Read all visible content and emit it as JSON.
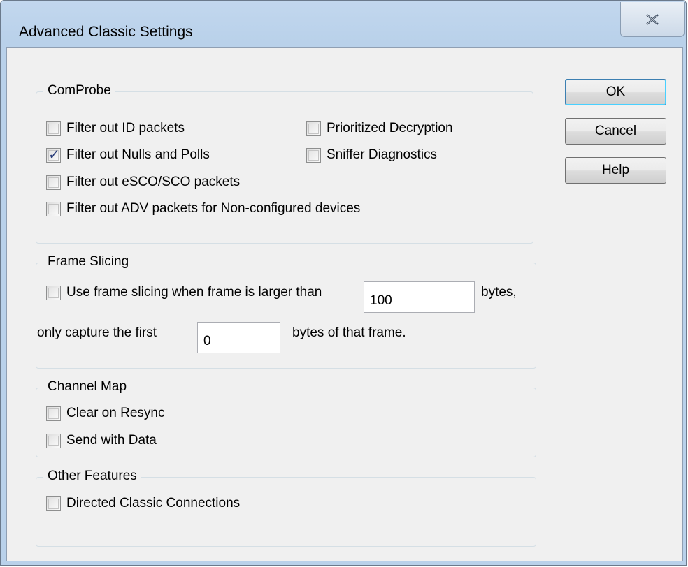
{
  "window": {
    "title": "Advanced Classic Settings",
    "close_icon": "close-x-icon"
  },
  "buttons": {
    "ok": "OK",
    "cancel": "Cancel",
    "help": "Help"
  },
  "comprobe": {
    "legend": "ComProbe",
    "options": [
      {
        "label": "Filter out ID packets",
        "checked": false
      },
      {
        "label": "Filter out Nulls and Polls",
        "checked": true
      },
      {
        "label": "Filter out eSCO/SCO packets",
        "checked": false
      },
      {
        "label": "Filter out ADV packets for Non-configured devices",
        "checked": false
      },
      {
        "label": "Prioritized Decryption",
        "checked": false
      },
      {
        "label": "Sniffer Diagnostics",
        "checked": false
      }
    ]
  },
  "frame_slicing": {
    "legend": "Frame Slicing",
    "use_label": "Use frame slicing when frame is larger than",
    "use_checked": false,
    "larger_than_value": "100",
    "bytes_label": "bytes,",
    "capture_label": "only capture the first",
    "capture_value": "0",
    "bytes_of_frame_label": "bytes of that frame."
  },
  "channel_map": {
    "legend": "Channel Map",
    "options": [
      {
        "label": "Clear on Resync",
        "checked": false
      },
      {
        "label": "Send with Data",
        "checked": false
      }
    ]
  },
  "other_features": {
    "legend": "Other Features",
    "options": [
      {
        "label": "Directed Classic Connections",
        "checked": false
      }
    ]
  }
}
